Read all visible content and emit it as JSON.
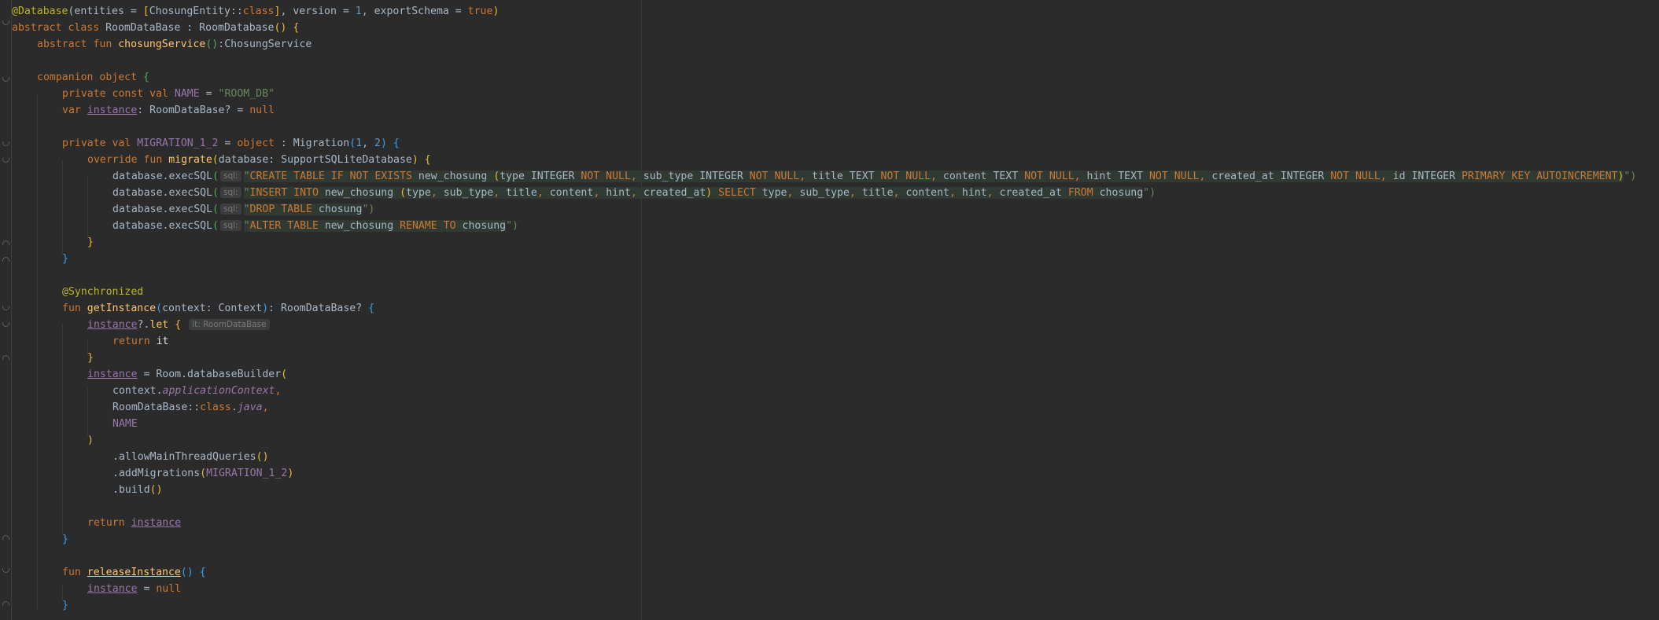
{
  "editor": {
    "language": "kotlin",
    "colors": {
      "background": "#2b2b2b",
      "keyword": "#cc7832",
      "annotation": "#bbb529",
      "function": "#ffc66d",
      "string": "#6a8759",
      "number": "#6897bb",
      "field": "#9876aa",
      "default": "#a9b7c6"
    },
    "tokens": {
      "l1_ann": "@Database",
      "l1_a": "(entities = ",
      "l1_b": "[",
      "l1_c": "ChosungEntity::",
      "l1_d": "class",
      "l1_e": "]",
      "l1_f": ", version = ",
      "l1_g": "1",
      "l1_h": ", exportSchema = ",
      "l1_i": "true",
      "l1_j": ")",
      "l2_a": "abstract class ",
      "l2_b": "RoomDataBase : RoomDatabase",
      "l2_c": "()",
      "l2_d": " ",
      "l2_e": "{",
      "l3_a": "abstract fun ",
      "l3_b": "chosungService",
      "l3_c": "()",
      "l3_d": ":ChosungService",
      "l5_a": "companion object ",
      "l5_b": "{",
      "l6_a": "private const val ",
      "l6_b": "NAME",
      "l6_c": " = ",
      "l6_d": "\"ROOM_DB\"",
      "l7_a": "var ",
      "l7_b": "instance",
      "l7_c": ": RoomDataBase? = ",
      "l7_d": "null",
      "l9_a": "private val ",
      "l9_b": "MIGRATION_1_2",
      "l9_c": " = ",
      "l9_d": "object",
      "l9_e": " : Migration",
      "l9_f": "(",
      "l9_g": "1",
      "l9_h": ", ",
      "l9_i": "2",
      "l9_j": ")",
      "l9_k": " ",
      "l9_l": "{",
      "l10_a": "override fun ",
      "l10_b": "migrate",
      "l10_c": "(",
      "l10_d": "database: SupportSQLiteDatabase",
      "l10_e": ")",
      "l10_f": " ",
      "l10_g": "{",
      "exec": "database.execSQL",
      "paren_open": "(",
      "sql_hint": "sql:",
      "q": "\"",
      "close_q_paren": "\")",
      "l11_a": "CREATE TABLE IF NOT EXISTS",
      "l11_b": " new_chosung ",
      "l11_c": "(",
      "l11_d": "type INTEGER ",
      "l11_e": "NOT NULL,",
      "l11_f": " sub_type INTEGER ",
      "l11_g": "NOT NULL,",
      "l11_h": " title TEXT ",
      "l11_i": "NOT NULL,",
      "l11_j": " content TEXT ",
      "l11_k": "NOT NULL,",
      "l11_l": " hint TEXT ",
      "l11_m": "NOT NULL,",
      "l11_n": " created_at INTEGER ",
      "l11_o": "NOT NULL,",
      "l11_p": " id INTEGER ",
      "l11_q": "PRIMARY KEY AUTOINCREMENT",
      "l11_r": ")",
      "l12_a": "INSERT INTO",
      "l12_b": " new_chosung ",
      "l12_c": "(",
      "l12_d": "type",
      "l12_e": ", ",
      "l12_f": "sub_type",
      "l12_g": ", ",
      "l12_h": "title",
      "l12_i": ", ",
      "l12_j": "content",
      "l12_k": ", ",
      "l12_l": "hint",
      "l12_m": ", ",
      "l12_n": "created_at",
      "l12_o": ")",
      "l12_p": " SELECT",
      "l12_q": " type",
      "l12_r": ", ",
      "l12_s": "sub_type",
      "l12_t": ", ",
      "l12_u": "title",
      "l12_v": ", ",
      "l12_w": "content",
      "l12_x": ", ",
      "l12_y": "hint",
      "l12_z": ", ",
      "l12_aa": "created_at ",
      "l12_ab": "FROM",
      "l12_ac": " chosung",
      "l13_a": "DROP TABLE",
      "l13_b": " chosung",
      "l14_a": "ALTER TABLE",
      "l14_b": " new_chosung ",
      "l14_c": "RENAME TO",
      "l14_d": " chosung",
      "brace_close": "}",
      "l18_ann": "@Synchronized",
      "l19_a": "fun ",
      "l19_b": "getInstance",
      "l19_c": "(",
      "l19_d": "context: Context",
      "l19_e": ")",
      "l19_f": ": RoomDataBase? ",
      "l19_g": "{",
      "l20_a": "instance",
      "l20_b": "?.",
      "l20_c": "let",
      "l20_d": " ",
      "l20_e": "{",
      "l20_hint": "it: RoomDataBase",
      "l21_a": "return ",
      "l21_b": "it",
      "l23_a": "instance",
      "l23_b": " = Room.databaseBuilder",
      "l23_c": "(",
      "l24_a": "context.",
      "l24_b": "applicationContext",
      "l24_c": ",",
      "l25_a": "RoomDataBase::",
      "l25_b": "class",
      "l25_c": ".",
      "l25_d": "java",
      "l25_e": ",",
      "l26_a": "NAME",
      "l27_a": ")",
      "l28_a": ".allowMainThreadQueries",
      "l28_b": "()",
      "l29_a": ".addMigrations",
      "l29_b": "(",
      "l29_c": "MIGRATION_1_2",
      "l29_d": ")",
      "l30_a": ".build",
      "l30_b": "()",
      "l32_a": "return ",
      "l32_b": "instance",
      "l35_a": "fun ",
      "l35_b": "releaseInstance",
      "l35_c": "()",
      "l35_d": " ",
      "l35_e": "{",
      "l36_a": "instance",
      "l36_b": " = ",
      "l36_c": "null"
    }
  }
}
